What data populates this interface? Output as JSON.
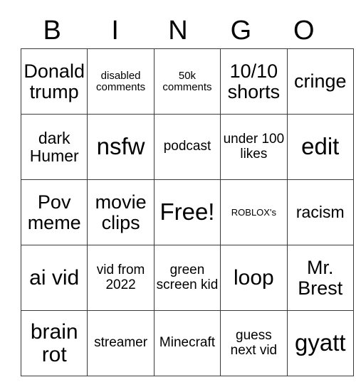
{
  "card": {
    "header_letters": [
      "B",
      "I",
      "N",
      "G",
      "O"
    ],
    "columns": 5,
    "rows": 5,
    "free_space": "Free!",
    "border_color": "#3a3a3a",
    "background_color": "#ffffff",
    "text_color": "#000000",
    "cells": [
      [
        {
          "text": "Donald trump",
          "size": "xl"
        },
        {
          "text": "disabled comments",
          "size": "sm"
        },
        {
          "text": "50k comments",
          "size": "sm"
        },
        {
          "text": "10/10 shorts",
          "size": "xl"
        },
        {
          "text": "cringe",
          "size": "xl"
        }
      ],
      [
        {
          "text": "dark Humer",
          "size": "lg"
        },
        {
          "text": "nsfw",
          "size": "3xl"
        },
        {
          "text": "podcast",
          "size": "md"
        },
        {
          "text": "under 100 likes",
          "size": "md"
        },
        {
          "text": "edit",
          "size": "3xl"
        }
      ],
      [
        {
          "text": "Pov meme",
          "size": "xl"
        },
        {
          "text": "movie clips",
          "size": "xl"
        },
        {
          "text": "Free!",
          "size": "3xl"
        },
        {
          "text": "ROBLOX's",
          "size": "xs"
        },
        {
          "text": "racism",
          "size": "lg"
        }
      ],
      [
        {
          "text": "ai vid",
          "size": "2xl"
        },
        {
          "text": "vid from 2022",
          "size": "md"
        },
        {
          "text": "green screen kid",
          "size": "md"
        },
        {
          "text": "loop",
          "size": "2xl"
        },
        {
          "text": "Mr. Brest",
          "size": "xl"
        }
      ],
      [
        {
          "text": "brain rot",
          "size": "2xl"
        },
        {
          "text": "streamer",
          "size": "md"
        },
        {
          "text": "Minecraft",
          "size": "md"
        },
        {
          "text": "guess next vid",
          "size": "md"
        },
        {
          "text": "gyatt",
          "size": "3xl"
        }
      ]
    ]
  }
}
